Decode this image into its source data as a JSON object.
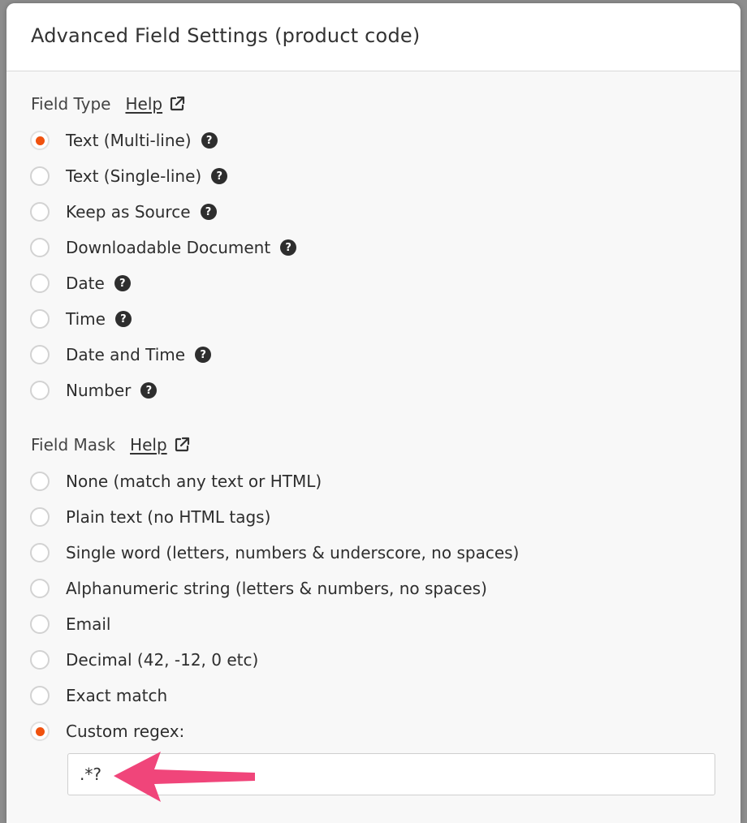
{
  "modal": {
    "title": "Advanced Field Settings (product code)"
  },
  "field_type": {
    "heading": "Field Type",
    "help_label": "Help",
    "options": [
      {
        "label": "Text (Multi-line)",
        "checked": true
      },
      {
        "label": "Text (Single-line)",
        "checked": false
      },
      {
        "label": "Keep as Source",
        "checked": false
      },
      {
        "label": "Downloadable Document",
        "checked": false
      },
      {
        "label": "Date",
        "checked": false
      },
      {
        "label": "Time",
        "checked": false
      },
      {
        "label": "Date and Time",
        "checked": false
      },
      {
        "label": "Number",
        "checked": false
      }
    ]
  },
  "field_mask": {
    "heading": "Field Mask",
    "help_label": "Help",
    "options": [
      {
        "label": "None (match any text or HTML)",
        "checked": false
      },
      {
        "label": "Plain text (no HTML tags)",
        "checked": false
      },
      {
        "label": "Single word (letters, numbers & underscore, no spaces)",
        "checked": false
      },
      {
        "label": "Alphanumeric string (letters & numbers, no spaces)",
        "checked": false
      },
      {
        "label": "Email",
        "checked": false
      },
      {
        "label": "Decimal (42, -12, 0 etc)",
        "checked": false
      },
      {
        "label": "Exact match",
        "checked": false
      },
      {
        "label": "Custom regex:",
        "checked": true
      }
    ],
    "custom_regex_value": ".*?"
  },
  "icons": {
    "help": "question-circle-icon",
    "external_link": "external-link-icon",
    "annotation": "pink-arrow-icon"
  },
  "colors": {
    "accent": "#f0520f",
    "annotation_arrow": "#f0457a"
  }
}
